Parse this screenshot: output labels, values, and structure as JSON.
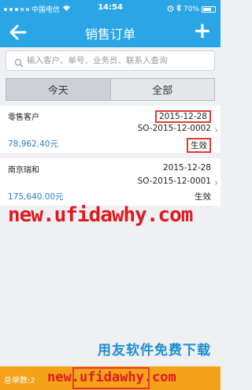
{
  "status_bar": {
    "carrier": "中国电信",
    "time": "14:54",
    "battery": "70%",
    "battery_level": 0.7
  },
  "nav": {
    "title": "销售订单",
    "back_icon": "back-arrow-icon",
    "add_icon": "plus-icon",
    "add_label": "+"
  },
  "search": {
    "placeholder": "输入客户、单号、业务员、联系人查询"
  },
  "segments": {
    "today": "今天",
    "all": "全部"
  },
  "orders": [
    {
      "customer": "零售客户",
      "date": "2015-12-28",
      "order_no": "SO-2015-12-0002",
      "amount": "78,962.40元",
      "status": "生效"
    },
    {
      "customer": "南京瑞和",
      "date": "2015-12-28",
      "order_no": "SO-2015-12-0001",
      "amount": "175,640.00元",
      "status": "生效"
    }
  ],
  "footer": {
    "total_label": "总单数:2"
  },
  "watermarks": {
    "url_text": "new.ufidawhy.com",
    "promo_text": "用友软件免费下载",
    "footer_url_text": "new.ufidawhy.com"
  },
  "colors": {
    "primary": "#2aa5e6",
    "accent_orange": "#f5a21b",
    "amount_blue": "#2a7fc6",
    "highlight_red": "#e53935"
  }
}
